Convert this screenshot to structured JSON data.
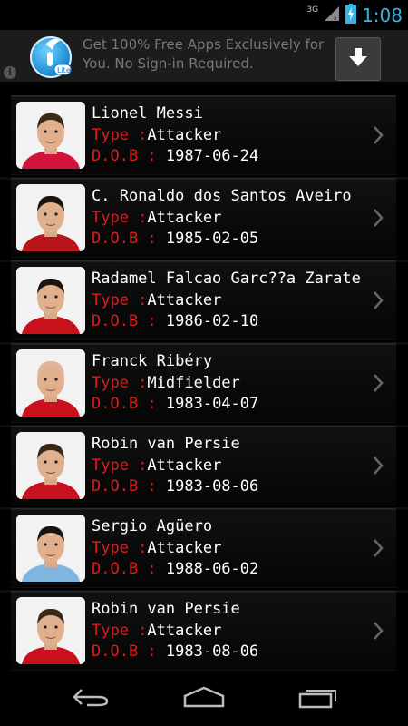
{
  "status_bar": {
    "network": "3G",
    "time": "1:08"
  },
  "ad": {
    "logo_badge": "Lite",
    "text": "Get 100% Free Apps Exclusively for You. No Sign-in Required.",
    "info_glyph": "i"
  },
  "players": [
    {
      "name": "Lionel Messi",
      "type_label": "Type :",
      "type": "Attacker",
      "dob_label": "D.O.B : ",
      "dob": "1987-06-24"
    },
    {
      "name": "C. Ronaldo dos Santos Aveiro",
      "type_label": "Type :",
      "type": "Attacker",
      "dob_label": "D.O.B : ",
      "dob": "1985-02-05"
    },
    {
      "name": "Radamel Falcao Garc??a Zarate",
      "type_label": "Type :",
      "type": "Attacker",
      "dob_label": "D.O.B : ",
      "dob": "1986-02-10"
    },
    {
      "name": "Franck Ribéry",
      "type_label": "Type :",
      "type": "Midfielder",
      "dob_label": "D.O.B : ",
      "dob": "1983-04-07"
    },
    {
      "name": "Robin van Persie",
      "type_label": "Type :",
      "type": "Attacker",
      "dob_label": "D.O.B : ",
      "dob": "1983-08-06"
    },
    {
      "name": "Sergio Agüero",
      "type_label": "Type :",
      "type": "Attacker",
      "dob_label": "D.O.B : ",
      "dob": "1988-06-02"
    },
    {
      "name": "Robin van Persie",
      "type_label": "Type :",
      "type": "Attacker",
      "dob_label": "D.O.B : ",
      "dob": "1983-08-06"
    }
  ],
  "icons": {
    "signal": "signal-icon",
    "battery": "battery-charging-icon",
    "download": "download-icon",
    "row_chevron": "chevron-right-icon",
    "back": "back-icon",
    "home": "home-icon",
    "recents": "recent-apps-icon"
  },
  "colors": {
    "label_red": "#e01b1b",
    "clock_blue": "#33b5e5",
    "background": "#000000"
  }
}
